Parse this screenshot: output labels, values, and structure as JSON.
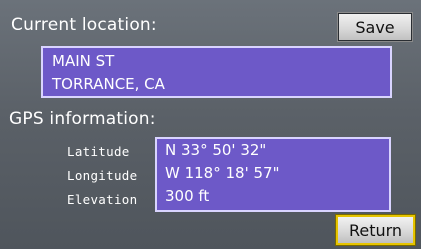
{
  "current_location": {
    "heading": "Current location:",
    "lines": [
      "MAIN ST",
      "TORRANCE, CA"
    ]
  },
  "gps_information": {
    "heading": "GPS information:",
    "fields": [
      {
        "label": "Latitude",
        "value": "N 33° 50' 32\""
      },
      {
        "label": "Longitude",
        "value": "W 118° 18' 57\""
      },
      {
        "label": "Elevation",
        "value": "300 ft"
      }
    ]
  },
  "buttons": {
    "save": "Save",
    "return": "Return"
  },
  "colors": {
    "value_box": "#6d59c8",
    "value_box_border": "#d9d4ff",
    "focus_highlight": "#e6c400",
    "background": "#5b6168"
  }
}
